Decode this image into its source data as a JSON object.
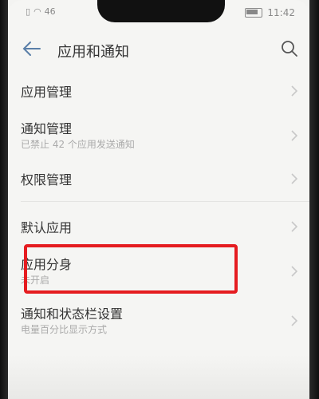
{
  "status_bar": {
    "left_text": "46",
    "time": "11:42"
  },
  "header": {
    "title": "应用和通知",
    "back_icon": "arrow-left-icon",
    "search_icon": "search-icon"
  },
  "items": [
    {
      "label": "应用管理",
      "sub": ""
    },
    {
      "label": "通知管理",
      "sub": "已禁止 42 个应用发送通知"
    },
    {
      "label": "权限管理",
      "sub": ""
    },
    {
      "label": "默认应用",
      "sub": ""
    },
    {
      "label": "应用分身",
      "sub": "未开启"
    },
    {
      "label": "通知和状态栏设置",
      "sub": "电量百分比显示方式"
    }
  ],
  "colors": {
    "highlight": "#e51c20",
    "text": "#333333",
    "subtext": "#aaaaaa"
  }
}
